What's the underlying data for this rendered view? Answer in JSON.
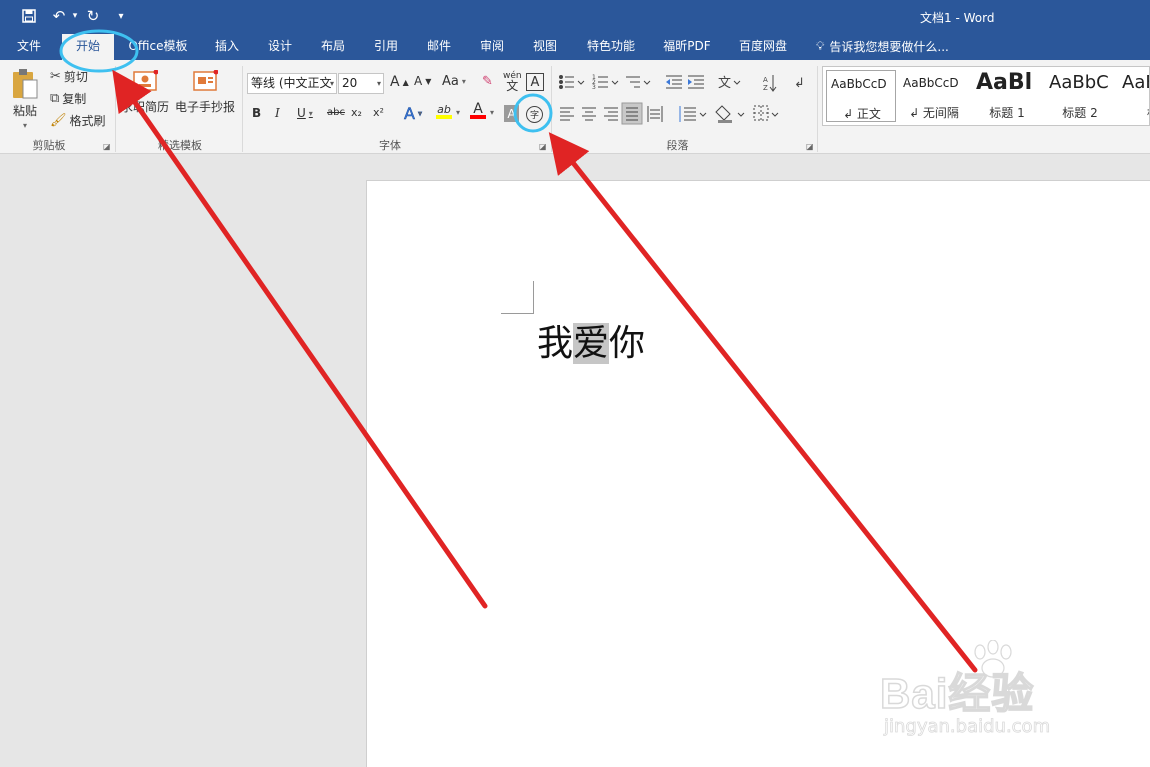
{
  "window": {
    "title": "文档1 - Word"
  },
  "quick_access": {
    "save_icon": "save-icon",
    "undo_icon": "undo-icon",
    "redo_icon": "redo-icon",
    "customize_icon": "customize-icon"
  },
  "tabs": [
    {
      "label": "文件"
    },
    {
      "label": "开始"
    },
    {
      "label": "Office模板"
    },
    {
      "label": "插入"
    },
    {
      "label": "设计"
    },
    {
      "label": "布局"
    },
    {
      "label": "引用"
    },
    {
      "label": "邮件"
    },
    {
      "label": "审阅"
    },
    {
      "label": "视图"
    },
    {
      "label": "特色功能"
    },
    {
      "label": "福昕PDF"
    },
    {
      "label": "百度网盘"
    }
  ],
  "tell_me": {
    "text": "告诉我您想要做什么..."
  },
  "clipboard": {
    "paste": "粘贴",
    "cut": "剪切",
    "copy": "复制",
    "format_painter": "格式刷",
    "group": "剪贴板"
  },
  "templates": {
    "resume": "求职简历",
    "handwritten": "电子手抄报",
    "group": "精选模板"
  },
  "font": {
    "name": "等线 (中文正文",
    "size": "20",
    "aa": "Aa",
    "grow": "A",
    "shrink": "A",
    "wen": "wén",
    "wen_char": "文",
    "boxed": "A",
    "bold": "B",
    "italic": "I",
    "underline": "U",
    "strike": "abc",
    "sub": "x₂",
    "sup": "x²",
    "highlight_label": "ab",
    "color_label": "A",
    "shade_label": "A",
    "enclose_char": "字",
    "group": "字体"
  },
  "paragraph": {
    "group": "段落"
  },
  "styles": [
    {
      "preview": "AaBbCcD",
      "name": "↲ 正文"
    },
    {
      "preview": "AaBbCcD",
      "name": "↲ 无间隔"
    },
    {
      "preview": "AaBl",
      "name": "标题 1"
    },
    {
      "preview": "AaBbC",
      "name": "标题 2"
    },
    {
      "preview": "AaB",
      "name": "标"
    }
  ],
  "document": {
    "text_before": "我",
    "text_highlight": "爱",
    "text_after": "你"
  },
  "watermark": {
    "brand": "Bai经验",
    "url": "jingyan.baidu.com"
  },
  "colors": {
    "title_bar": "#2b579a",
    "ribbon": "#f3f3f3",
    "annotation_arrow": "#e02424",
    "annotation_circle": "#3ec0f0",
    "highlight_yellow": "#ffff00",
    "font_red": "#ff0000"
  }
}
